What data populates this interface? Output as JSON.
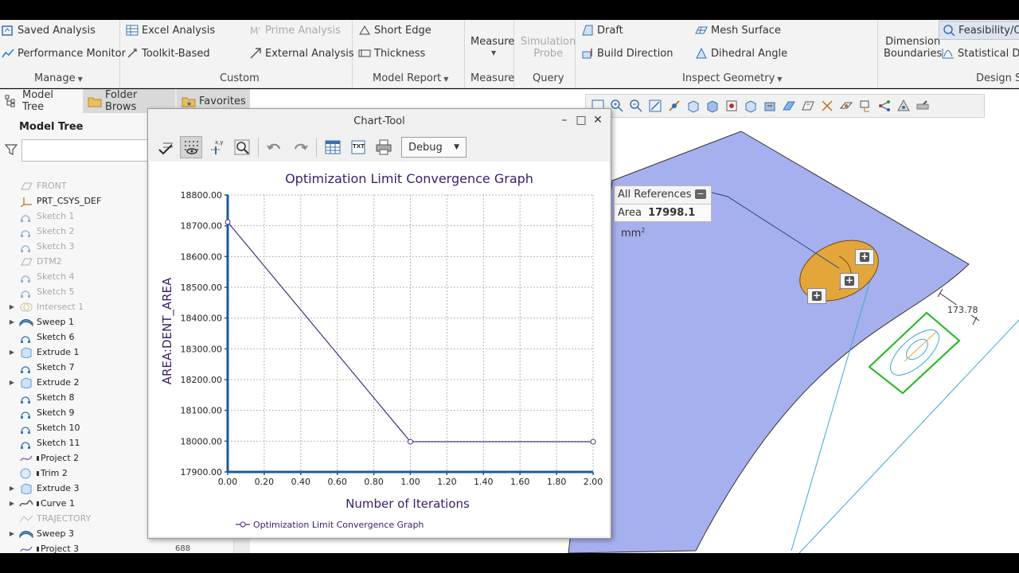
{
  "ribbon": {
    "manage": {
      "saved_analysis": "Saved Analysis",
      "performance_monitor": "Performance Monitor",
      "label": "Manage"
    },
    "custom": {
      "excel_analysis": "Excel Analysis",
      "toolkit_based": "Toolkit-Based",
      "prime_analysis": "Prime Analysis",
      "external_analysis": "External Analysis",
      "label": "Custom"
    },
    "model_report": {
      "short_edge": "Short Edge",
      "thickness": "Thickness",
      "label": "Model Report"
    },
    "measure": {
      "measure": "Measure",
      "label": "Measure"
    },
    "query": {
      "simulation_probe_1": "Simulation",
      "simulation_probe_2": "Probe",
      "label": "Query"
    },
    "inspect_geometry": {
      "draft": "Draft",
      "build_direction": "Build Direction",
      "mesh_surface": "Mesh Surface",
      "dihedral_angle": "Dihedral Angle",
      "label": "Inspect Geometry"
    },
    "design_study": {
      "dimension_boundaries_1": "Dimension",
      "dimension_boundaries_2": "Boundaries",
      "feasibility": "Feasibility/Op",
      "statistical": "Statistical De",
      "label": "Design St"
    }
  },
  "tabs": {
    "model_tree": "Model Tree",
    "folder_browser": "Folder Brows",
    "favorites": "Favorites"
  },
  "model_tree": {
    "title": "Model Tree",
    "search_placeholder": "",
    "items": [
      {
        "label": "FRONT",
        "dim": true,
        "expand": false,
        "icon": "datum-plane-icon",
        "color": "#b0b0b0"
      },
      {
        "label": "PRT_CSYS_DEF",
        "dim": false,
        "expand": false,
        "icon": "csys-icon",
        "color": "#c07020"
      },
      {
        "label": "Sketch 1",
        "dim": true,
        "expand": false,
        "icon": "sketch-icon",
        "color": "#8fb3d6"
      },
      {
        "label": "Sketch 2",
        "dim": true,
        "expand": false,
        "icon": "sketch-icon",
        "color": "#8fb3d6"
      },
      {
        "label": "Sketch 3",
        "dim": true,
        "expand": false,
        "icon": "sketch-icon",
        "color": "#8fb3d6"
      },
      {
        "label": "DTM2",
        "dim": true,
        "expand": false,
        "icon": "datum-plane-icon",
        "color": "#b0b0b0"
      },
      {
        "label": "Sketch 4",
        "dim": true,
        "expand": false,
        "icon": "sketch-icon",
        "color": "#8fb3d6"
      },
      {
        "label": "Sketch 5",
        "dim": true,
        "expand": false,
        "icon": "sketch-icon",
        "color": "#8fb3d6"
      },
      {
        "label": "Intersect 1",
        "dim": true,
        "expand": true,
        "icon": "intersect-icon",
        "color": "#c9c9a0"
      },
      {
        "label": "Sweep 1",
        "dim": false,
        "expand": true,
        "icon": "sweep-icon",
        "color": "#5a8fc4"
      },
      {
        "label": "Sketch 6",
        "dim": false,
        "expand": false,
        "icon": "sketch-icon",
        "color": "#3a78b8"
      },
      {
        "label": "Extrude 1",
        "dim": false,
        "expand": true,
        "icon": "extrude-icon",
        "color": "#5a9ad6"
      },
      {
        "label": "Sketch 7",
        "dim": false,
        "expand": false,
        "icon": "sketch-icon",
        "color": "#3a78b8"
      },
      {
        "label": "Extrude 2",
        "dim": false,
        "expand": true,
        "icon": "extrude-icon",
        "color": "#5a9ad6"
      },
      {
        "label": "Sketch 8",
        "dim": false,
        "expand": false,
        "icon": "sketch-icon",
        "color": "#3a78b8"
      },
      {
        "label": "Sketch 9",
        "dim": false,
        "expand": false,
        "icon": "sketch-icon",
        "color": "#3a78b8"
      },
      {
        "label": "Sketch 10",
        "dim": false,
        "expand": false,
        "icon": "sketch-icon",
        "color": "#3a78b8"
      },
      {
        "label": "Sketch 11",
        "dim": false,
        "expand": false,
        "icon": "sketch-icon",
        "color": "#3a78b8"
      },
      {
        "label": "Project 2",
        "dim": false,
        "expand": false,
        "icon": "project-icon",
        "color": "#8a6fb0",
        "marker": true
      },
      {
        "label": "Trim 2",
        "dim": false,
        "expand": false,
        "icon": "trim-icon",
        "color": "#6a9ad0",
        "marker": true
      },
      {
        "label": "Extrude 3",
        "dim": false,
        "expand": true,
        "icon": "extrude-icon",
        "color": "#5a9ad6"
      },
      {
        "label": "Curve 1",
        "dim": false,
        "expand": true,
        "icon": "curve-icon",
        "color": "#555555",
        "marker": true
      },
      {
        "label": "TRAJECTORY",
        "dim": true,
        "expand": false,
        "icon": "trajectory-icon",
        "color": "#bbbbbb"
      },
      {
        "label": "Sweep 3",
        "dim": false,
        "expand": true,
        "icon": "sweep-icon",
        "color": "#5a8fc4"
      },
      {
        "label": "Project 3",
        "dim": false,
        "expand": false,
        "icon": "project-icon",
        "color": "#8a6fb0",
        "marker": true,
        "number": "688"
      }
    ]
  },
  "dialog": {
    "title": "Chart-Tool",
    "debug_select": "Debug"
  },
  "callout": {
    "header": "All References",
    "area_label": "Area",
    "area_value": "17998.1",
    "area_unit": "mm",
    "area_unit_sup": "2"
  },
  "dimension_value": "173.78",
  "colors": {
    "surface": "#a7b0ee",
    "feature_orange": "#e4a63a",
    "selection_green": "#1eb81e",
    "chart_series": "#4a2d7a",
    "chart_axis": "#1e5a9a"
  },
  "chart_data": {
    "type": "line",
    "title": "Optimization Limit Convergence Graph",
    "xlabel": "Number of Iterations",
    "ylabel": "AREA:DENT_AREA",
    "xlim": [
      0,
      2
    ],
    "ylim": [
      17900,
      18800
    ],
    "x_ticks": [
      "0.00",
      "0.20",
      "0.40",
      "0.60",
      "0.80",
      "1.00",
      "1.20",
      "1.40",
      "1.60",
      "1.80",
      "2.00"
    ],
    "y_ticks": [
      "17900.00",
      "18000.00",
      "18100.00",
      "18200.00",
      "18300.00",
      "18400.00",
      "18500.00",
      "18600.00",
      "18700.00",
      "18800.00"
    ],
    "grid": true,
    "legend_position": "bottom-left",
    "series": [
      {
        "name": "Optimization Limit Convergence Graph",
        "x": [
          0,
          1,
          2
        ],
        "y": [
          18712,
          17998.1,
          17998.1
        ]
      }
    ]
  }
}
